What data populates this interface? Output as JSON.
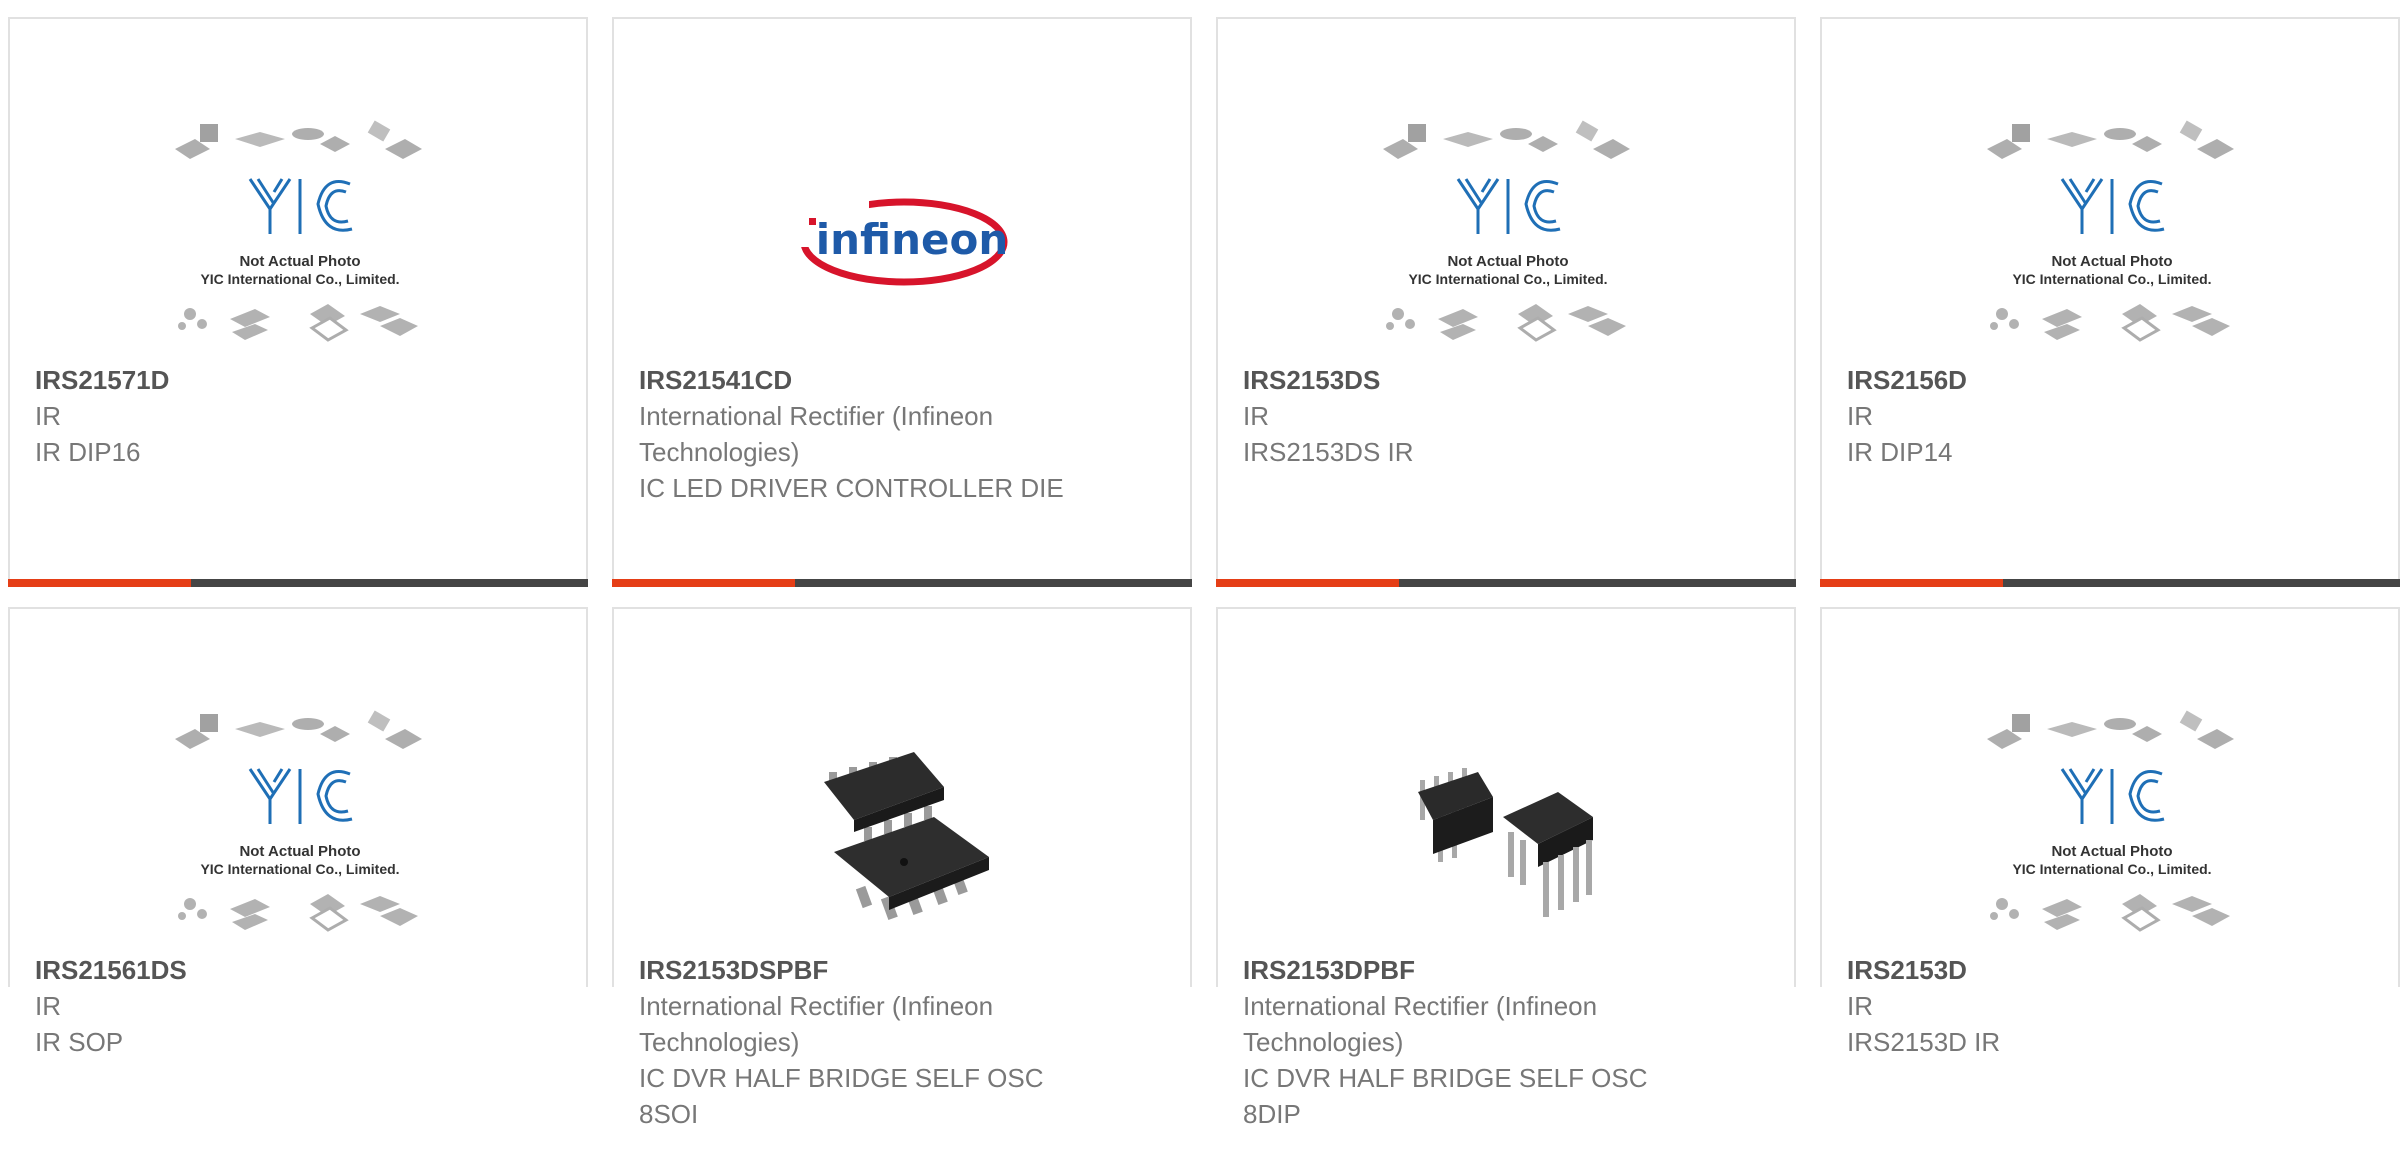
{
  "products": [
    {
      "pn": "IRS21571D",
      "mfr": "IR",
      "desc": "IR DIP16",
      "image": "yic-placeholder",
      "placeholder_title": "Not Actual Photo",
      "placeholder_sub": "YIC International Co., Limited."
    },
    {
      "pn": "IRS21541CD",
      "mfr": "International Rectifier (Infineon Technologies)",
      "desc": "IC LED DRIVER CONTROLLER DIE",
      "image": "infineon-logo",
      "logo_text": "infineon"
    },
    {
      "pn": "IRS2153DS",
      "mfr": "IR",
      "desc": "IRS2153DS IR",
      "image": "yic-placeholder",
      "placeholder_title": "Not Actual Photo",
      "placeholder_sub": "YIC International Co., Limited."
    },
    {
      "pn": "IRS2156D",
      "mfr": "IR",
      "desc": "IR DIP14",
      "image": "yic-placeholder",
      "placeholder_title": "Not Actual Photo",
      "placeholder_sub": "YIC International Co., Limited."
    },
    {
      "pn": "IRS21561DS",
      "mfr": "IR",
      "desc": "IR SOP",
      "image": "yic-placeholder",
      "placeholder_title": "Not Actual Photo",
      "placeholder_sub": "YIC International Co., Limited."
    },
    {
      "pn": "IRS2153DSPBF",
      "mfr": "International Rectifier (Infineon Technologies)",
      "desc": "IC DVR HALF BRIDGE SELF OSC 8SOI",
      "image": "soic-chip-photo"
    },
    {
      "pn": "IRS2153DPBF",
      "mfr": "International Rectifier (Infineon Technologies)",
      "desc": "IC DVR HALF BRIDGE SELF OSC 8DIP",
      "image": "dip-chip-photo"
    },
    {
      "pn": "IRS2153D",
      "mfr": "IR",
      "desc": "IRS2153D IR",
      "image": "yic-placeholder",
      "placeholder_title": "Not Actual Photo",
      "placeholder_sub": "YIC International Co., Limited."
    }
  ],
  "colors": {
    "accent": "#e53e16",
    "bar": "#454545",
    "border": "#e1e1e1",
    "logo_red": "#d7142b",
    "logo_blue": "#1e5aa8",
    "yic_blue": "#1f6fb6"
  }
}
